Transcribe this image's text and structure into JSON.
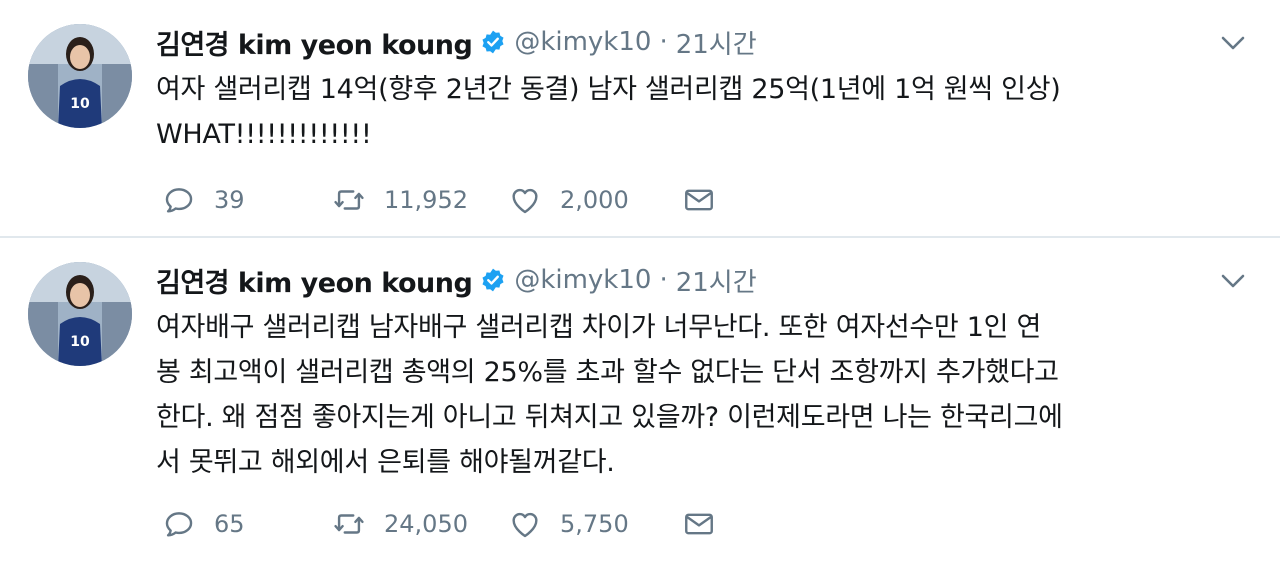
{
  "tweets": [
    {
      "name": "김연경 kim yeon koung",
      "handle": "@kimyk10",
      "separator": "·",
      "time": "21시간",
      "lines": [
        "여자 샐러리캡 14억(향후 2년간 동결) 남자 샐러리캡 25억(1년에 1억 원씩 인상)",
        "WHAT!!!!!!!!!!!!!"
      ],
      "replies": "39",
      "retweets": "11,952",
      "likes": "2,000"
    },
    {
      "name": "김연경 kim yeon koung",
      "handle": "@kimyk10",
      "separator": "·",
      "time": "21시간",
      "lines": [
        "여자배구 샐러리캡 남자배구 샐러리캡 차이가 너무난다. 또한 여자선수만 1인 연",
        "봉 최고액이 샐러리캡 총액의 25%를 초과 할수 없다는 단서 조항까지 추가했다고",
        "한다. 왜 점점 좋아지는게 아니고 뒤쳐지고 있을까? 이런제도라면 나는 한국리그에",
        "서 못뛰고 해외에서 은퇴를 해야될꺼같다."
      ],
      "replies": "65",
      "retweets": "24,050",
      "likes": "5,750"
    }
  ],
  "colors": {
    "text": "#14171a",
    "muted": "#657786",
    "verified": "#1da1f2",
    "divider": "#e1e8ed"
  },
  "icons": {
    "reply": "reply-icon",
    "retweet": "retweet-icon",
    "like": "heart-icon",
    "dm": "envelope-icon",
    "verified": "verified-badge-icon",
    "caret": "chevron-down-icon"
  }
}
